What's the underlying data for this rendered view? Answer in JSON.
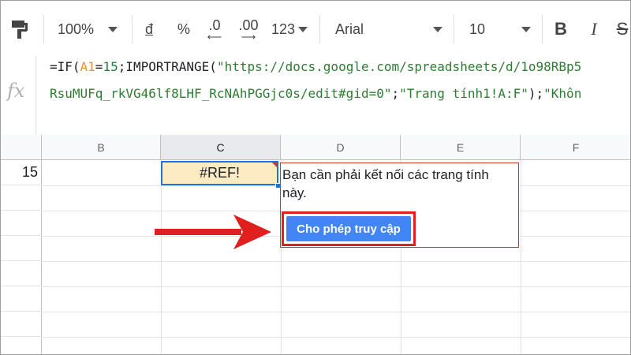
{
  "toolbar": {
    "zoom": "100%",
    "currency": "đ",
    "percent": "%",
    "decrease_decimal": ".0",
    "increase_decimal": ".00",
    "number_format": "123",
    "font": "Arial",
    "font_size": "10",
    "bold": "B",
    "italic": "I",
    "strike": "S"
  },
  "formula_bar": {
    "fx_label": "fx",
    "line1": {
      "p1": "=IF(",
      "p2": "A1",
      "p3": "=",
      "p4": "15",
      "p5": ";IMPORTRANGE(",
      "p6": "\"https://docs.google.com/spreadsheets/d/1o98RBp5"
    },
    "line2": {
      "p1": "RsuMUFq_rkVG46lf8LHF_RcNAhPGGjc0s/edit#gid=0\"",
      "p2": ";",
      "p3": "\"Trang tính1!A:F\"",
      "p4": ");",
      "p5": "\"Khôn"
    }
  },
  "grid": {
    "columns": [
      "B",
      "C",
      "D",
      "E",
      "F"
    ],
    "row_value": "15",
    "cell_c_value": "#REF!"
  },
  "popup": {
    "message": "Bạn cần phải kết nối các trang tính này.",
    "button_label": "Cho phép truy cập"
  },
  "colors": {
    "button": "#4285f4",
    "highlight_outline": "#e21f1f",
    "ref_cell_bg": "#fdebc4",
    "selection": "#1a73e8"
  }
}
